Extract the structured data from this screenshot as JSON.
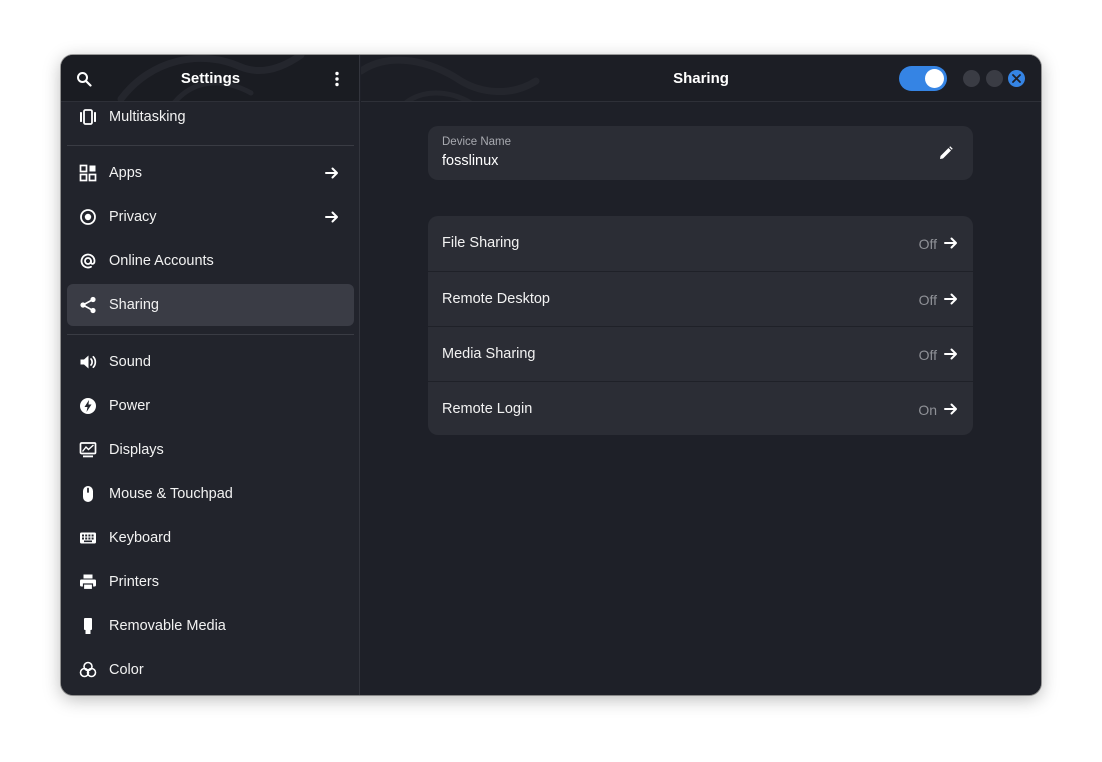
{
  "sidebar": {
    "title": "Settings",
    "search_icon": "search-icon",
    "menu_icon": "more-vertical-icon",
    "items": [
      {
        "label": "Multitasking",
        "icon": "multitasking-icon",
        "arrow": false,
        "active": false
      },
      {
        "label": "Apps",
        "icon": "apps-grid-icon",
        "arrow": true,
        "active": false
      },
      {
        "label": "Privacy",
        "icon": "privacy-icon",
        "arrow": true,
        "active": false
      },
      {
        "label": "Online Accounts",
        "icon": "at-sign-icon",
        "arrow": false,
        "active": false
      },
      {
        "label": "Sharing",
        "icon": "share-icon",
        "arrow": false,
        "active": true
      },
      {
        "label": "Sound",
        "icon": "speaker-icon",
        "arrow": false,
        "active": false
      },
      {
        "label": "Power",
        "icon": "power-bolt-icon",
        "arrow": false,
        "active": false
      },
      {
        "label": "Displays",
        "icon": "display-icon",
        "arrow": false,
        "active": false
      },
      {
        "label": "Mouse & Touchpad",
        "icon": "mouse-icon",
        "arrow": false,
        "active": false
      },
      {
        "label": "Keyboard",
        "icon": "keyboard-icon",
        "arrow": false,
        "active": false
      },
      {
        "label": "Printers",
        "icon": "printer-icon",
        "arrow": false,
        "active": false
      },
      {
        "label": "Removable Media",
        "icon": "usb-drive-icon",
        "arrow": false,
        "active": false
      },
      {
        "label": "Color",
        "icon": "color-circles-icon",
        "arrow": false,
        "active": false
      }
    ]
  },
  "main": {
    "title": "Sharing",
    "sharing_enabled": true,
    "device": {
      "label": "Device Name",
      "value": "fosslinux",
      "edit_icon": "pencil-icon"
    },
    "services": [
      {
        "label": "File Sharing",
        "status": "Off"
      },
      {
        "label": "Remote Desktop",
        "status": "Off"
      },
      {
        "label": "Media Sharing",
        "status": "Off"
      },
      {
        "label": "Remote Login",
        "status": "On"
      }
    ]
  },
  "colors": {
    "accent": "#3584e4",
    "window_bg": "#1e2028",
    "sidebar_bg": "#22242c",
    "card_bg": "#2b2d35",
    "active_item_bg": "#3a3c45"
  }
}
